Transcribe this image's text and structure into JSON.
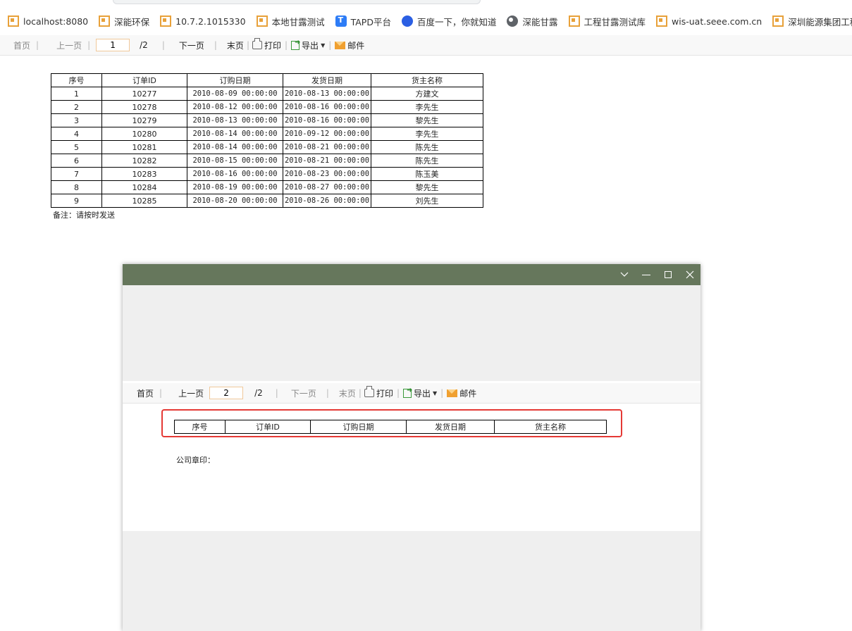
{
  "bookmarks": [
    {
      "label": "localhost:8080",
      "icon": "finereport-icon"
    },
    {
      "label": "深能环保",
      "icon": "finereport-icon"
    },
    {
      "label": "10.7.2.1015330",
      "icon": "finereport-icon"
    },
    {
      "label": "本地甘露测试",
      "icon": "finereport-icon"
    },
    {
      "label": "TAPD平台",
      "icon": "tapd-icon"
    },
    {
      "label": "百度一下，你就知道",
      "icon": "baidu-paw-icon"
    },
    {
      "label": "深能甘露",
      "icon": "globe-icon"
    },
    {
      "label": "工程甘露测试库",
      "icon": "finereport-icon"
    },
    {
      "label": "wis-uat.seee.com.cn",
      "icon": "finereport-icon"
    },
    {
      "label": "深圳能源集团工程...",
      "icon": "finereport-icon"
    }
  ],
  "toolbar": {
    "first": "首页",
    "prev": "上一页",
    "page": "1",
    "total": "/2",
    "next": "下一页",
    "last": "末页",
    "print": "打印",
    "export": "导出",
    "email": "邮件"
  },
  "table": {
    "headers": [
      "序号",
      "订单ID",
      "订购日期",
      "发货日期",
      "货主名称"
    ],
    "rows": [
      [
        "1",
        "10277",
        "2010-08-09 00:00:00",
        "2010-08-13 00:00:00",
        "方建文"
      ],
      [
        "2",
        "10278",
        "2010-08-12 00:00:00",
        "2010-08-16 00:00:00",
        "李先生"
      ],
      [
        "3",
        "10279",
        "2010-08-13 00:00:00",
        "2010-08-16 00:00:00",
        "黎先生"
      ],
      [
        "4",
        "10280",
        "2010-08-14 00:00:00",
        "2010-09-12 00:00:00",
        "李先生"
      ],
      [
        "5",
        "10281",
        "2010-08-14 00:00:00",
        "2010-08-21 00:00:00",
        "陈先生"
      ],
      [
        "6",
        "10282",
        "2010-08-15 00:00:00",
        "2010-08-21 00:00:00",
        "陈先生"
      ],
      [
        "7",
        "10283",
        "2010-08-16 00:00:00",
        "2010-08-23 00:00:00",
        "陈玉美"
      ],
      [
        "8",
        "10284",
        "2010-08-19 00:00:00",
        "2010-08-27 00:00:00",
        "黎先生"
      ],
      [
        "9",
        "10285",
        "2010-08-20 00:00:00",
        "2010-08-26 00:00:00",
        "刘先生"
      ]
    ],
    "note": "备注：请按时发送"
  },
  "popup": {
    "toolbar": {
      "first": "首页",
      "prev": "上一页",
      "page": "2",
      "total": "/2",
      "next": "下一页",
      "last": "末页",
      "print": "打印",
      "export": "导出",
      "email": "邮件"
    },
    "headers": [
      "序号",
      "订单ID",
      "订购日期",
      "发货日期",
      "货主名称"
    ],
    "stamp": "公司章印：",
    "highlight_color": "#e53935",
    "title_color": "#66775c"
  }
}
